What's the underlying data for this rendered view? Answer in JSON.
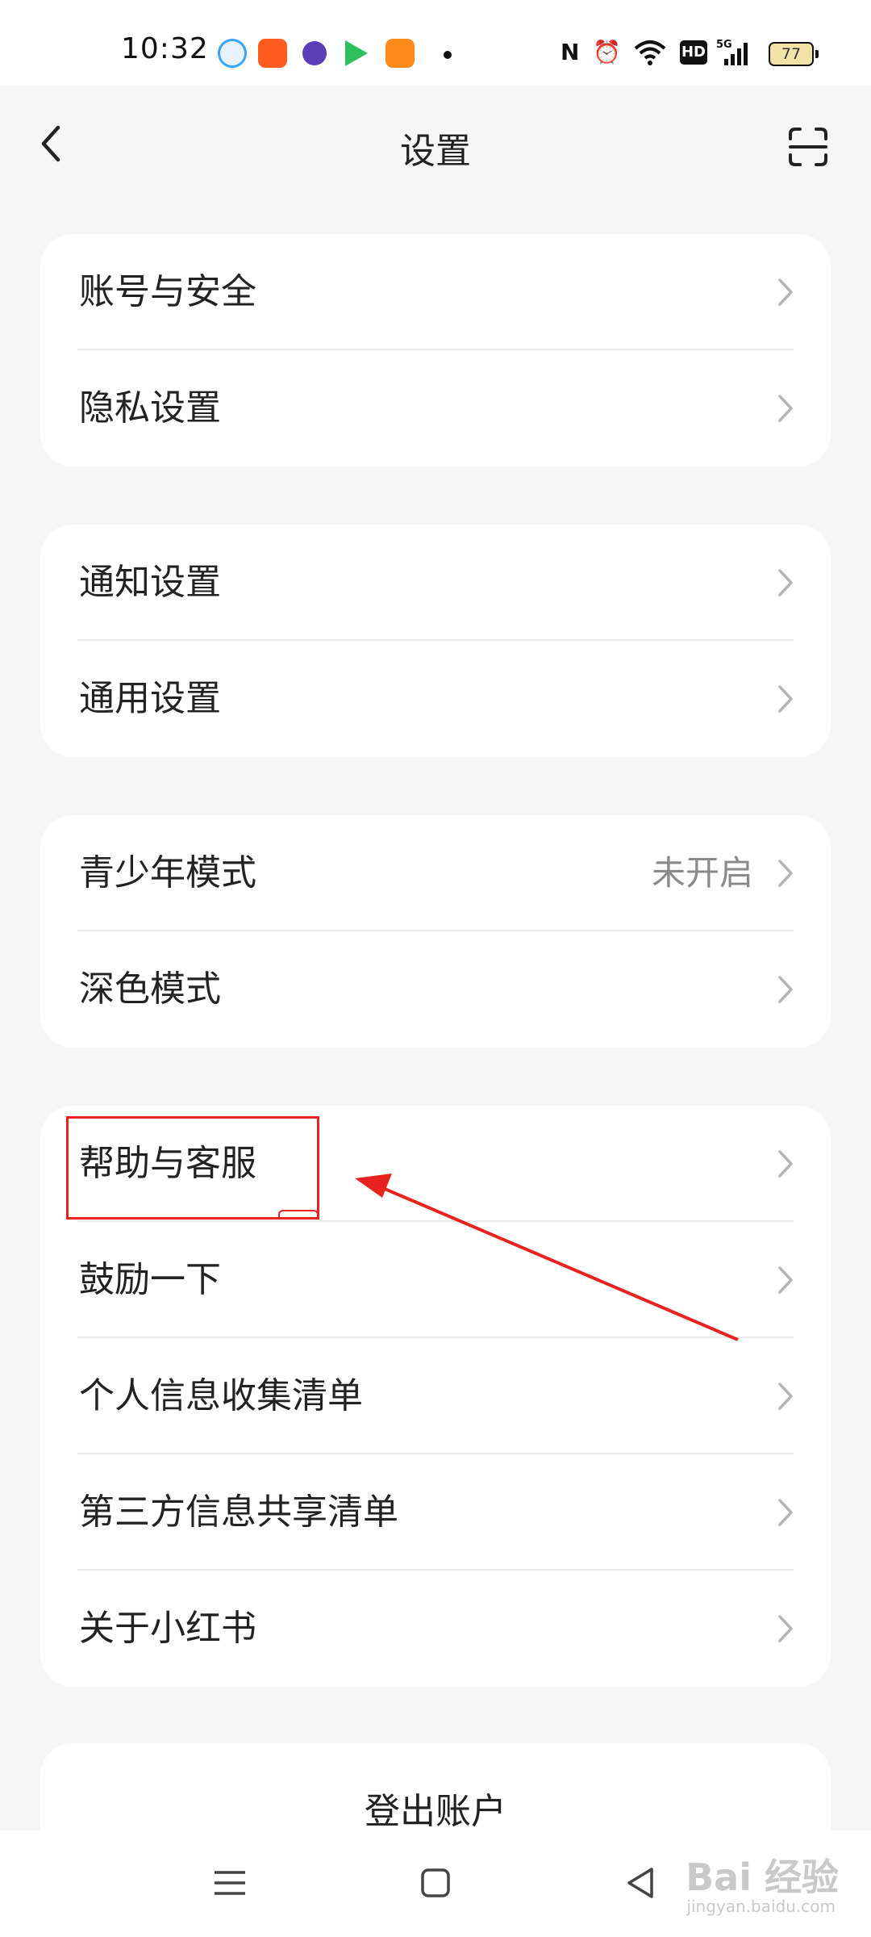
{
  "status": {
    "time": "10:32",
    "battery": "77",
    "network": "5G"
  },
  "header": {
    "title": "设置"
  },
  "groups": [
    {
      "items": [
        {
          "label": "账号与安全",
          "value": ""
        },
        {
          "label": "隐私设置",
          "value": ""
        }
      ]
    },
    {
      "items": [
        {
          "label": "通知设置",
          "value": ""
        },
        {
          "label": "通用设置",
          "value": ""
        }
      ]
    },
    {
      "items": [
        {
          "label": "青少年模式",
          "value": "未开启"
        },
        {
          "label": "深色模式",
          "value": ""
        }
      ]
    },
    {
      "items": [
        {
          "label": "帮助与客服",
          "value": ""
        },
        {
          "label": "鼓励一下",
          "value": ""
        },
        {
          "label": "个人信息收集清单",
          "value": ""
        },
        {
          "label": "第三方信息共享清单",
          "value": ""
        },
        {
          "label": "关于小红书",
          "value": ""
        }
      ]
    }
  ],
  "logout": {
    "label": "登出账户"
  },
  "watermark": {
    "brand": "Bai 经验",
    "url": "jingyan.baidu.com"
  },
  "colors": {
    "background": "#f6f6f6",
    "card": "#ffffff",
    "annotation": "#e8231f"
  }
}
